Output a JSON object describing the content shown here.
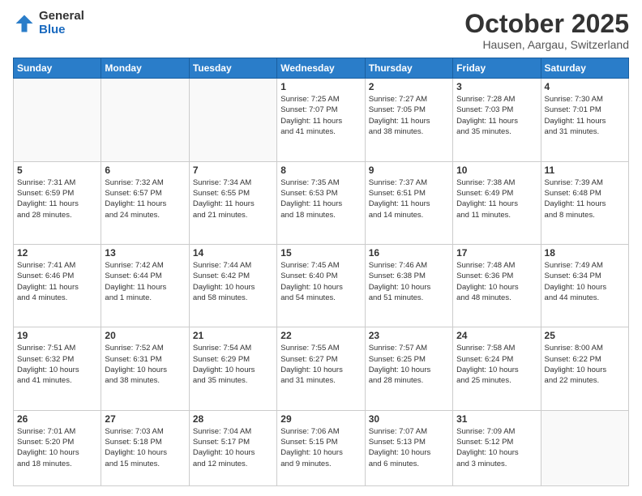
{
  "header": {
    "logo_general": "General",
    "logo_blue": "Blue",
    "month_title": "October 2025",
    "location": "Hausen, Aargau, Switzerland"
  },
  "weekdays": [
    "Sunday",
    "Monday",
    "Tuesday",
    "Wednesday",
    "Thursday",
    "Friday",
    "Saturday"
  ],
  "weeks": [
    [
      {
        "day": "",
        "info": ""
      },
      {
        "day": "",
        "info": ""
      },
      {
        "day": "",
        "info": ""
      },
      {
        "day": "1",
        "info": "Sunrise: 7:25 AM\nSunset: 7:07 PM\nDaylight: 11 hours\nand 41 minutes."
      },
      {
        "day": "2",
        "info": "Sunrise: 7:27 AM\nSunset: 7:05 PM\nDaylight: 11 hours\nand 38 minutes."
      },
      {
        "day": "3",
        "info": "Sunrise: 7:28 AM\nSunset: 7:03 PM\nDaylight: 11 hours\nand 35 minutes."
      },
      {
        "day": "4",
        "info": "Sunrise: 7:30 AM\nSunset: 7:01 PM\nDaylight: 11 hours\nand 31 minutes."
      }
    ],
    [
      {
        "day": "5",
        "info": "Sunrise: 7:31 AM\nSunset: 6:59 PM\nDaylight: 11 hours\nand 28 minutes."
      },
      {
        "day": "6",
        "info": "Sunrise: 7:32 AM\nSunset: 6:57 PM\nDaylight: 11 hours\nand 24 minutes."
      },
      {
        "day": "7",
        "info": "Sunrise: 7:34 AM\nSunset: 6:55 PM\nDaylight: 11 hours\nand 21 minutes."
      },
      {
        "day": "8",
        "info": "Sunrise: 7:35 AM\nSunset: 6:53 PM\nDaylight: 11 hours\nand 18 minutes."
      },
      {
        "day": "9",
        "info": "Sunrise: 7:37 AM\nSunset: 6:51 PM\nDaylight: 11 hours\nand 14 minutes."
      },
      {
        "day": "10",
        "info": "Sunrise: 7:38 AM\nSunset: 6:49 PM\nDaylight: 11 hours\nand 11 minutes."
      },
      {
        "day": "11",
        "info": "Sunrise: 7:39 AM\nSunset: 6:48 PM\nDaylight: 11 hours\nand 8 minutes."
      }
    ],
    [
      {
        "day": "12",
        "info": "Sunrise: 7:41 AM\nSunset: 6:46 PM\nDaylight: 11 hours\nand 4 minutes."
      },
      {
        "day": "13",
        "info": "Sunrise: 7:42 AM\nSunset: 6:44 PM\nDaylight: 11 hours\nand 1 minute."
      },
      {
        "day": "14",
        "info": "Sunrise: 7:44 AM\nSunset: 6:42 PM\nDaylight: 10 hours\nand 58 minutes."
      },
      {
        "day": "15",
        "info": "Sunrise: 7:45 AM\nSunset: 6:40 PM\nDaylight: 10 hours\nand 54 minutes."
      },
      {
        "day": "16",
        "info": "Sunrise: 7:46 AM\nSunset: 6:38 PM\nDaylight: 10 hours\nand 51 minutes."
      },
      {
        "day": "17",
        "info": "Sunrise: 7:48 AM\nSunset: 6:36 PM\nDaylight: 10 hours\nand 48 minutes."
      },
      {
        "day": "18",
        "info": "Sunrise: 7:49 AM\nSunset: 6:34 PM\nDaylight: 10 hours\nand 44 minutes."
      }
    ],
    [
      {
        "day": "19",
        "info": "Sunrise: 7:51 AM\nSunset: 6:32 PM\nDaylight: 10 hours\nand 41 minutes."
      },
      {
        "day": "20",
        "info": "Sunrise: 7:52 AM\nSunset: 6:31 PM\nDaylight: 10 hours\nand 38 minutes."
      },
      {
        "day": "21",
        "info": "Sunrise: 7:54 AM\nSunset: 6:29 PM\nDaylight: 10 hours\nand 35 minutes."
      },
      {
        "day": "22",
        "info": "Sunrise: 7:55 AM\nSunset: 6:27 PM\nDaylight: 10 hours\nand 31 minutes."
      },
      {
        "day": "23",
        "info": "Sunrise: 7:57 AM\nSunset: 6:25 PM\nDaylight: 10 hours\nand 28 minutes."
      },
      {
        "day": "24",
        "info": "Sunrise: 7:58 AM\nSunset: 6:24 PM\nDaylight: 10 hours\nand 25 minutes."
      },
      {
        "day": "25",
        "info": "Sunrise: 8:00 AM\nSunset: 6:22 PM\nDaylight: 10 hours\nand 22 minutes."
      }
    ],
    [
      {
        "day": "26",
        "info": "Sunrise: 7:01 AM\nSunset: 5:20 PM\nDaylight: 10 hours\nand 18 minutes."
      },
      {
        "day": "27",
        "info": "Sunrise: 7:03 AM\nSunset: 5:18 PM\nDaylight: 10 hours\nand 15 minutes."
      },
      {
        "day": "28",
        "info": "Sunrise: 7:04 AM\nSunset: 5:17 PM\nDaylight: 10 hours\nand 12 minutes."
      },
      {
        "day": "29",
        "info": "Sunrise: 7:06 AM\nSunset: 5:15 PM\nDaylight: 10 hours\nand 9 minutes."
      },
      {
        "day": "30",
        "info": "Sunrise: 7:07 AM\nSunset: 5:13 PM\nDaylight: 10 hours\nand 6 minutes."
      },
      {
        "day": "31",
        "info": "Sunrise: 7:09 AM\nSunset: 5:12 PM\nDaylight: 10 hours\nand 3 minutes."
      },
      {
        "day": "",
        "info": ""
      }
    ]
  ]
}
